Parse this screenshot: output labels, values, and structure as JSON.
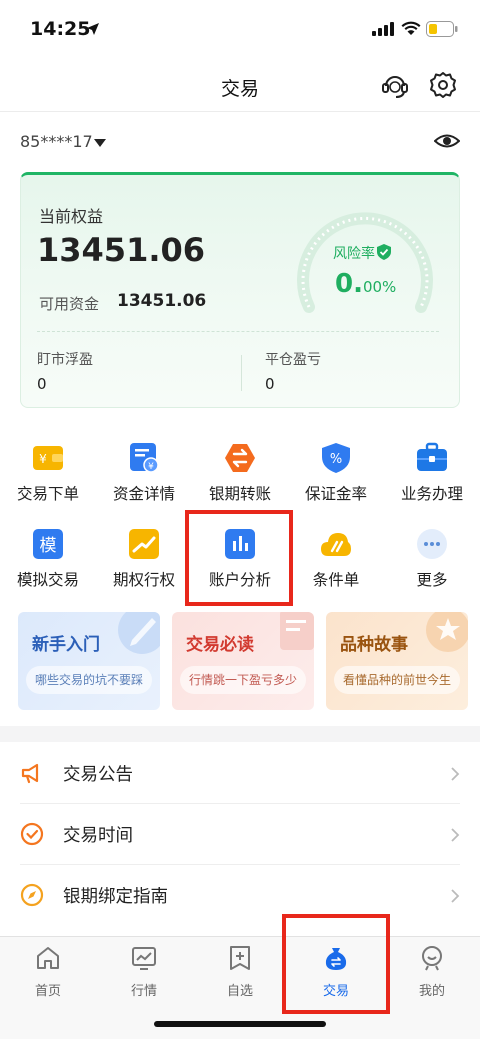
{
  "status_bar": {
    "time": "14:25"
  },
  "header": {
    "title": "交易"
  },
  "account": {
    "id": "85****17"
  },
  "equity": {
    "label": "当前权益",
    "value": "13451.06",
    "available_label": "可用资金",
    "available_value": "13451.06",
    "risk_label": "风险率",
    "risk_value_main": "0.",
    "risk_value_sub": "00%",
    "float_pnl_label": "盯市浮盈",
    "float_pnl_value": "0",
    "close_pnl_label": "平仓盈亏",
    "close_pnl_value": "0",
    "accent_color": "#1fb565"
  },
  "functions": [
    {
      "label": "交易下单",
      "icon": "order-icon"
    },
    {
      "label": "资金详情",
      "icon": "funds-detail-icon"
    },
    {
      "label": "银期转账",
      "icon": "transfer-icon"
    },
    {
      "label": "保证金率",
      "icon": "margin-rate-icon"
    },
    {
      "label": "业务办理",
      "icon": "briefcase-icon"
    },
    {
      "label": "模拟交易",
      "icon": "simulate-icon"
    },
    {
      "label": "期权行权",
      "icon": "option-exercise-icon"
    },
    {
      "label": "账户分析",
      "icon": "account-analysis-icon"
    },
    {
      "label": "条件单",
      "icon": "conditional-order-icon"
    },
    {
      "label": "更多",
      "icon": "more-icon"
    }
  ],
  "promos": [
    {
      "title": "新手入门",
      "subtitle": "哪些交易的坑不要踩",
      "color": "#2b5fb8"
    },
    {
      "title": "交易必读",
      "subtitle": "行情跳一下盈亏多少",
      "color": "#d23a30"
    },
    {
      "title": "品种故事",
      "subtitle": "看懂品种的前世今生",
      "color": "#9a5410"
    }
  ],
  "list": [
    {
      "label": "交易公告",
      "icon": "megaphone-icon"
    },
    {
      "label": "交易时间",
      "icon": "clock-check-icon"
    },
    {
      "label": "银期绑定指南",
      "icon": "compass-icon"
    }
  ],
  "tabs": [
    {
      "label": "首页",
      "icon": "home-icon",
      "active": false
    },
    {
      "label": "行情",
      "icon": "chart-icon",
      "active": false
    },
    {
      "label": "自选",
      "icon": "watchlist-icon",
      "active": false
    },
    {
      "label": "交易",
      "icon": "trade-bag-icon",
      "active": true
    },
    {
      "label": "我的",
      "icon": "profile-icon",
      "active": false
    }
  ],
  "active_tab_color": "#1a6bea",
  "highlight_color": "#e8271b"
}
